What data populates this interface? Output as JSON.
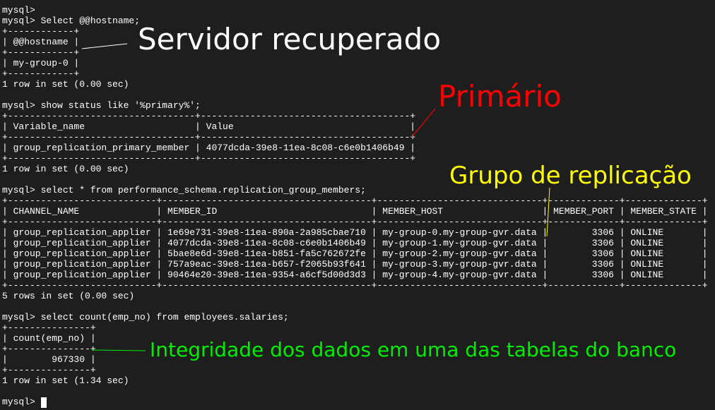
{
  "terminal": {
    "lines": [
      "mysql>",
      "mysql> Select @@hostname;",
      "+------------+",
      "| @@hostname |",
      "+------------+",
      "| my-group-0 |",
      "+------------+",
      "1 row in set (0.00 sec)",
      "",
      "mysql> show status like '%primary%';",
      "+----------------------------------+--------------------------------------+",
      "| Variable_name                    | Value                                |",
      "+----------------------------------+--------------------------------------+",
      "| group_replication_primary_member | 4077dcda-39e8-11ea-8c08-c6e0b1406b49 |",
      "+----------------------------------+--------------------------------------+",
      "1 row in set (0.00 sec)",
      "",
      "mysql> select * from performance_schema.replication_group_members;",
      "+---------------------------+--------------------------------------+------------------------------+-------------+--------------+",
      "| CHANNEL_NAME              | MEMBER_ID                            | MEMBER_HOST                  | MEMBER_PORT | MEMBER_STATE |",
      "+---------------------------+--------------------------------------+------------------------------+-------------+--------------+",
      "| group_replication_applier | 1e69e731-39e8-11ea-890a-2a985cbae710 | my-group-0.my-group-gvr.data |        3306 | ONLINE       |",
      "| group_replication_applier | 4077dcda-39e8-11ea-8c08-c6e0b1406b49 | my-group-1.my-group-gvr.data |        3306 | ONLINE       |",
      "| group_replication_applier | 5bae8e6d-39e8-11ea-b851-fa5c762672fe | my-group-2.my-group-gvr.data |        3306 | ONLINE       |",
      "| group_replication_applier | 757a9eac-39e8-11ea-b657-f2065b93f641 | my-group-3.my-group-gvr.data |        3306 | ONLINE       |",
      "| group_replication_applier | 90464e20-39e8-11ea-9354-a6cf5d00d3d3 | my-group-4.my-group-gvr.data |        3306 | ONLINE       |",
      "+---------------------------+--------------------------------------+------------------------------+-------------+--------------+",
      "5 rows in set (0.00 sec)",
      "",
      "mysql> select count(emp_no) from employees.salaries;",
      "+---------------+",
      "| count(emp_no) |",
      "+---------------+",
      "|        967330 |",
      "+---------------+",
      "1 row in set (1.34 sec)",
      "",
      "mysql> "
    ]
  },
  "annotations": {
    "server": {
      "text": "Servidor recuperado",
      "color": "#ffffff"
    },
    "primary": {
      "text": "Primário",
      "color": "#ff0000"
    },
    "group": {
      "text": "Grupo de replicação",
      "color": "#ffff00"
    },
    "integrity": {
      "text": "Integridade dos dados em uma das tabelas do banco",
      "color": "#00ee00"
    }
  },
  "colors": {
    "background": "#1e1e1e",
    "terminal_text": "#ffffff"
  }
}
